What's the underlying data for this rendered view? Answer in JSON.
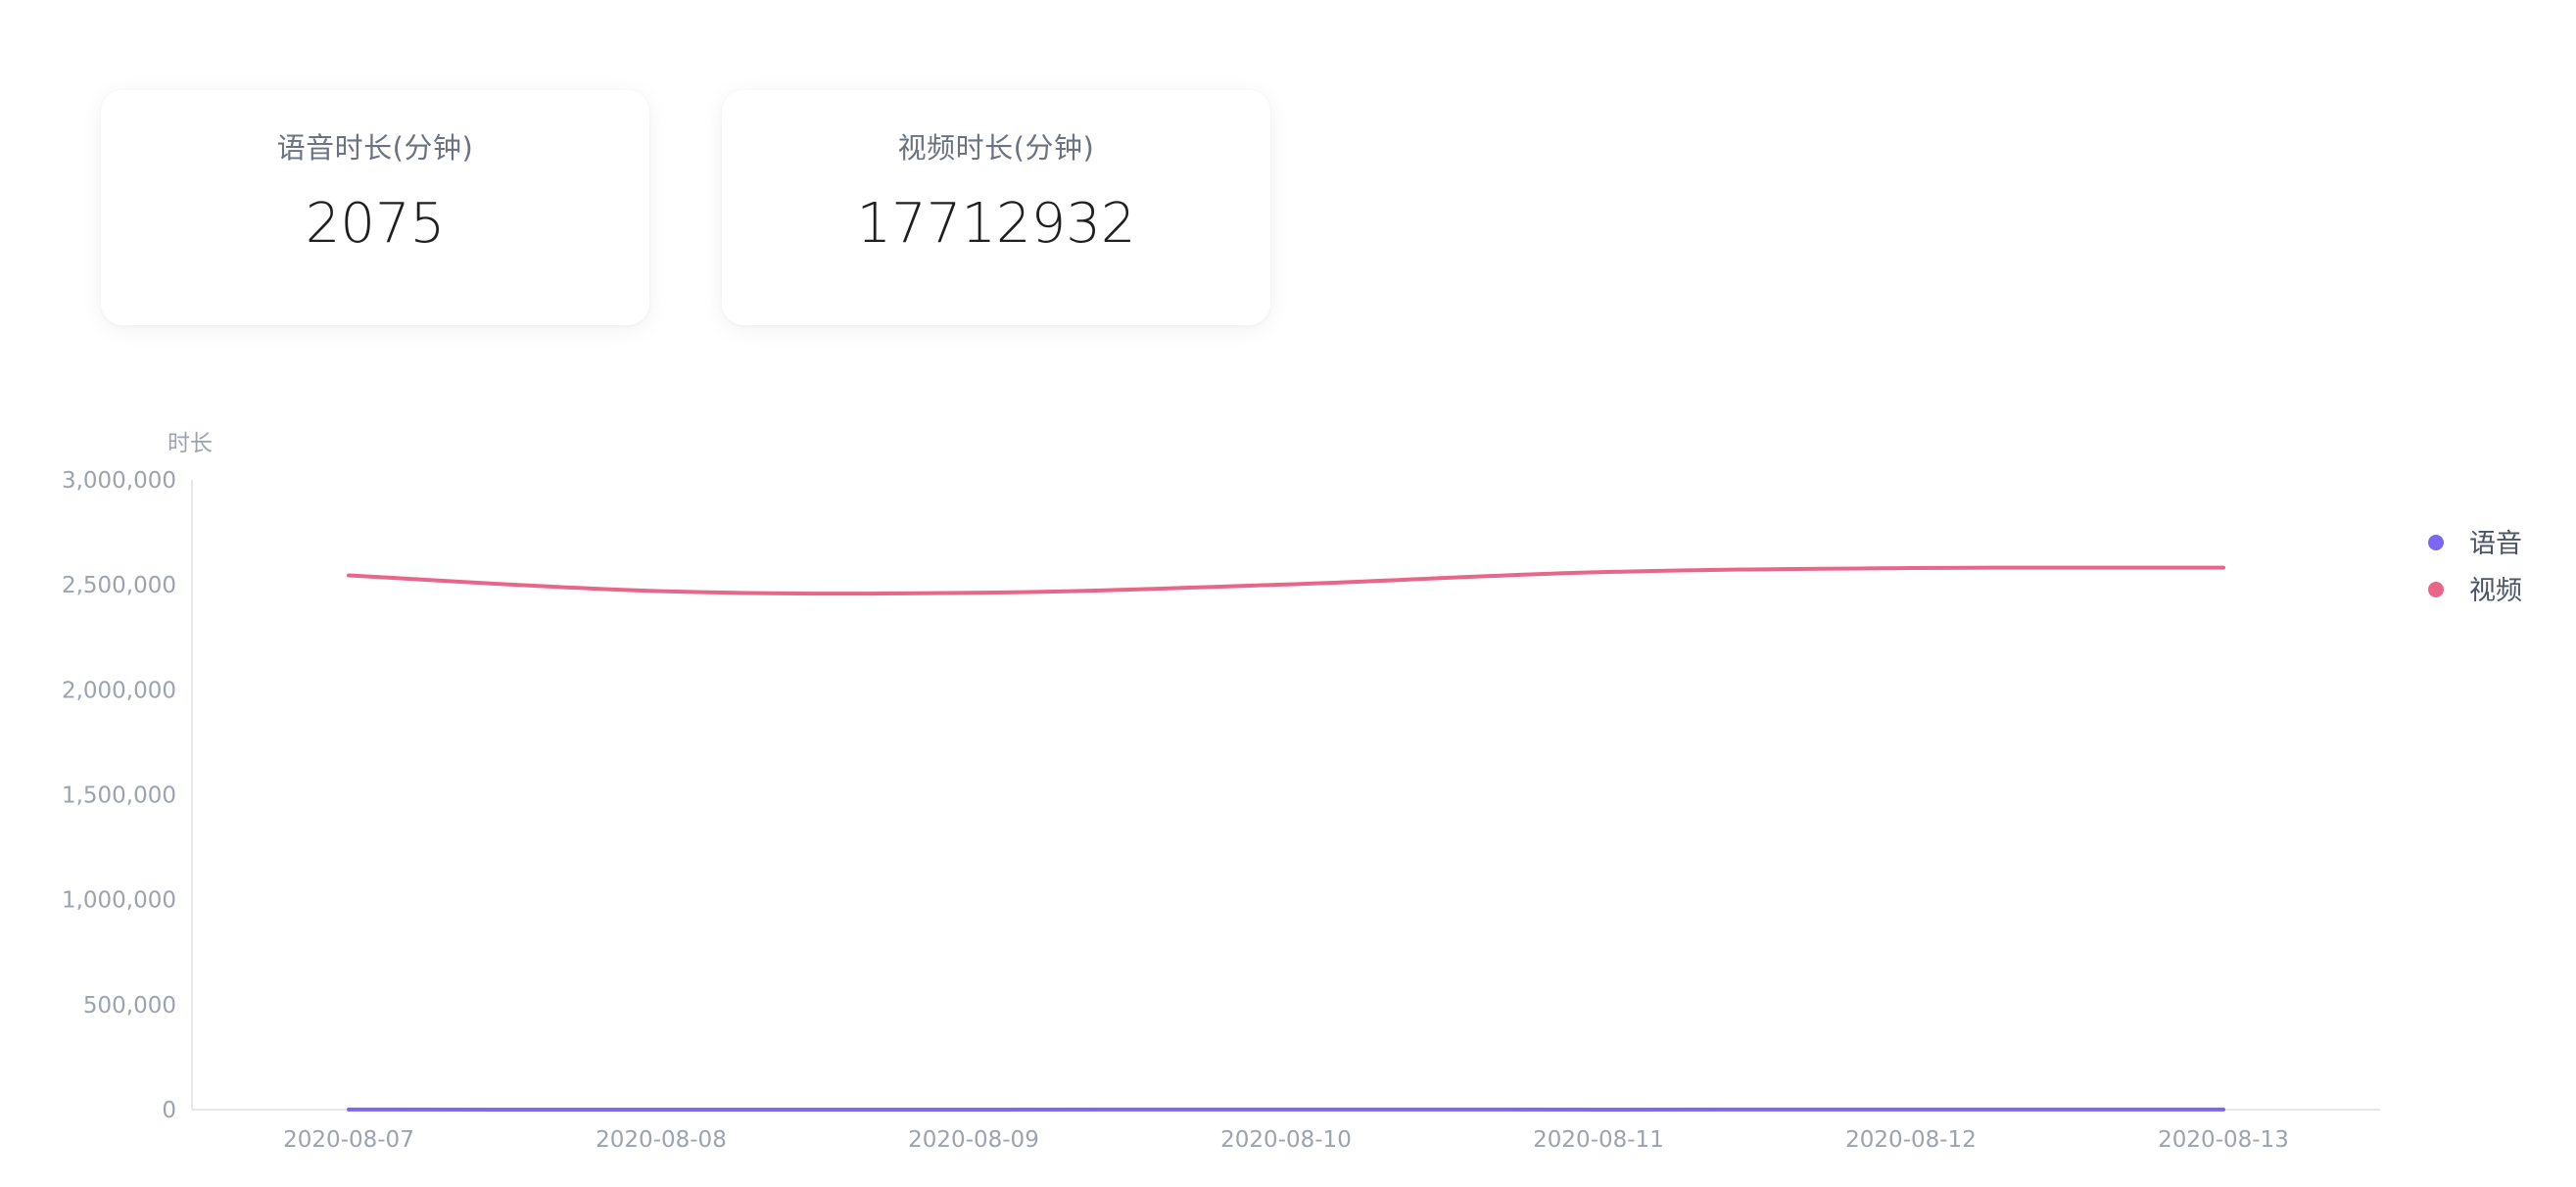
{
  "cards": [
    {
      "label": "语音时长(分钟)",
      "value": "2075"
    },
    {
      "label": "视频时长(分钟)",
      "value": "17712932"
    }
  ],
  "chart_data": {
    "type": "line",
    "ylabel": "时长",
    "x": [
      "2020-08-07",
      "2020-08-08",
      "2020-08-09",
      "2020-08-10",
      "2020-08-11",
      "2020-08-12",
      "2020-08-13"
    ],
    "ylim": [
      0,
      3000000
    ],
    "yticks": [
      0,
      500000,
      1000000,
      1500000,
      2000000,
      2500000,
      3000000
    ],
    "ytick_labels": [
      "0",
      "500,000",
      "1,000,000",
      "1,500,000",
      "2,000,000",
      "2,500,000",
      "3,000,000"
    ],
    "legend_position": "right",
    "series": [
      {
        "name": "语音",
        "color": "#7b68ee",
        "values": [
          300,
          280,
          290,
          300,
          290,
          310,
          305
        ]
      },
      {
        "name": "视频",
        "color": "#e8668a",
        "values": [
          2545000,
          2470000,
          2462000,
          2502000,
          2560000,
          2580000,
          2582000
        ]
      }
    ]
  }
}
